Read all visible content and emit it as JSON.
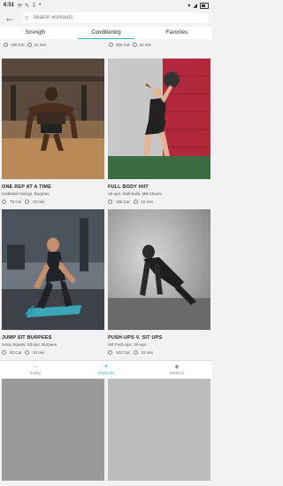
{
  "status": {
    "time": "6:51"
  },
  "search": {
    "placeholder": "Search workouts"
  },
  "tabs": [
    {
      "label": "Strength",
      "active": false
    },
    {
      "label": "Conditioning",
      "active": true
    },
    {
      "label": "Favorites",
      "active": false
    }
  ],
  "previous_row": [
    {
      "cal": "160 Cal",
      "min": "15 min"
    },
    {
      "cal": "200 Cal",
      "min": "15 min"
    }
  ],
  "cards": [
    {
      "title": "ONE REP AT A TIME",
      "subtitle": "Kettlebell Swings, Burpees",
      "cal": "79 Cal",
      "min": "10 min"
    },
    {
      "title": "FULL BODY HIIT",
      "subtitle": "Sit-ups, Wall Balls, MB Cleans",
      "cal": "106 Cal",
      "min": "10 min"
    },
    {
      "title": "JUMP SIT BURPEES",
      "subtitle": "Jump Squats, Sit-ups, Burpees",
      "cal": "83 Cal",
      "min": "10 min"
    },
    {
      "title": "PUSH-UPS V. SIT UPS",
      "subtitle": "HR Push-ups, Sit-ups",
      "cal": "102 Cal",
      "min": "15 min"
    }
  ],
  "nav": [
    {
      "label": "Today",
      "icon": "home-icon",
      "active": false
    },
    {
      "label": "Workouts",
      "icon": "workouts-icon",
      "active": true
    },
    {
      "label": "Nutrition",
      "icon": "nutrition-icon",
      "active": false
    }
  ],
  "colors": {
    "accent": "#39b8c4"
  }
}
